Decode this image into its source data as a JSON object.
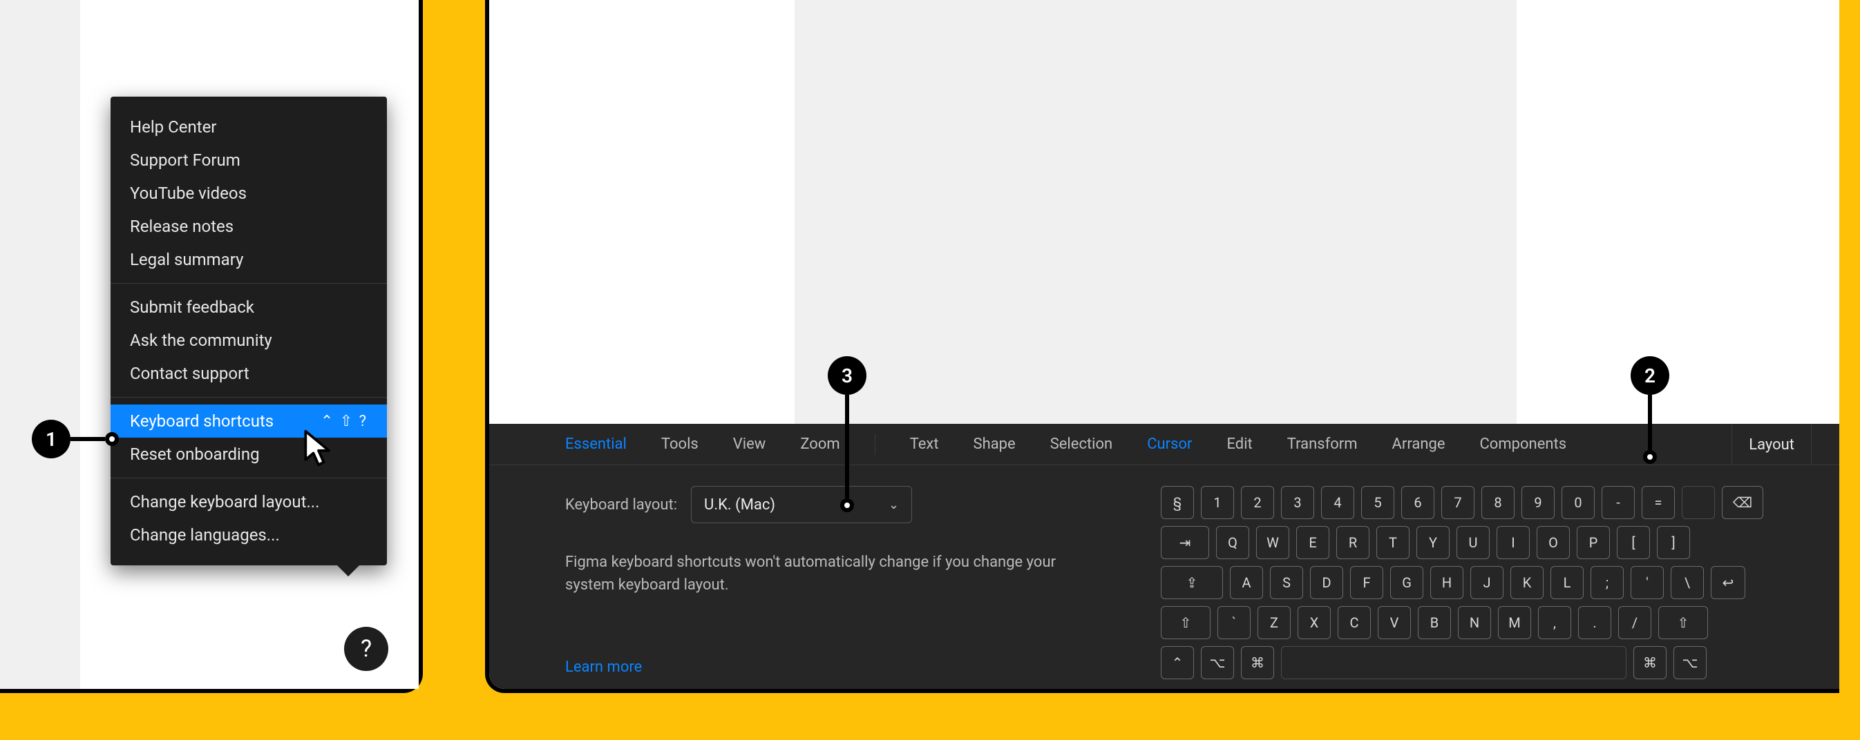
{
  "annotations": {
    "m1": "1",
    "m2": "2",
    "m3": "3"
  },
  "help_menu": {
    "group1": [
      "Help Center",
      "Support Forum",
      "YouTube videos",
      "Release notes",
      "Legal summary"
    ],
    "group2": [
      "Submit feedback",
      "Ask the community",
      "Contact support"
    ],
    "group3": {
      "keyboard_shortcuts": {
        "label": "Keyboard shortcuts",
        "shortcut": "⌃ ⇧ ?"
      },
      "reset_onboarding": "Reset onboarding"
    },
    "group4": [
      "Change keyboard layout...",
      "Change languages..."
    ]
  },
  "help_button": "?",
  "shortcuts": {
    "tabs": {
      "essential": "Essential",
      "tools": "Tools",
      "view": "View",
      "zoom": "Zoom",
      "text": "Text",
      "shape": "Shape",
      "selection": "Selection",
      "cursor": "Cursor",
      "edit": "Edit",
      "transform": "Transform",
      "arrange": "Arrange",
      "components": "Components",
      "layout": "Layout"
    },
    "keyboard_layout_label": "Keyboard layout:",
    "keyboard_layout_value": "U.K. (Mac)",
    "description": "Figma keyboard shortcuts won't automatically change if you change your system keyboard layout.",
    "learn_more": "Learn more"
  },
  "keyboard": {
    "row1": [
      "§",
      "1",
      "2",
      "3",
      "4",
      "5",
      "6",
      "7",
      "8",
      "9",
      "0",
      "-",
      "="
    ],
    "row2": [
      "Q",
      "W",
      "E",
      "R",
      "T",
      "Y",
      "U",
      "I",
      "O",
      "P",
      "[",
      "]"
    ],
    "row3": [
      "A",
      "S",
      "D",
      "F",
      "G",
      "H",
      "J",
      "K",
      "L",
      ";",
      "'",
      "\\"
    ],
    "row4": [
      "`",
      "Z",
      "X",
      "C",
      "V",
      "B",
      "N",
      "M",
      ",",
      ".",
      "/"
    ],
    "glyphs": {
      "backspace": "⌫",
      "tab": "⇥",
      "caps": "⇪",
      "enter": "↩",
      "shift": "⇧",
      "ctrl": "⌃",
      "opt": "⌥",
      "cmd": "⌘"
    }
  }
}
